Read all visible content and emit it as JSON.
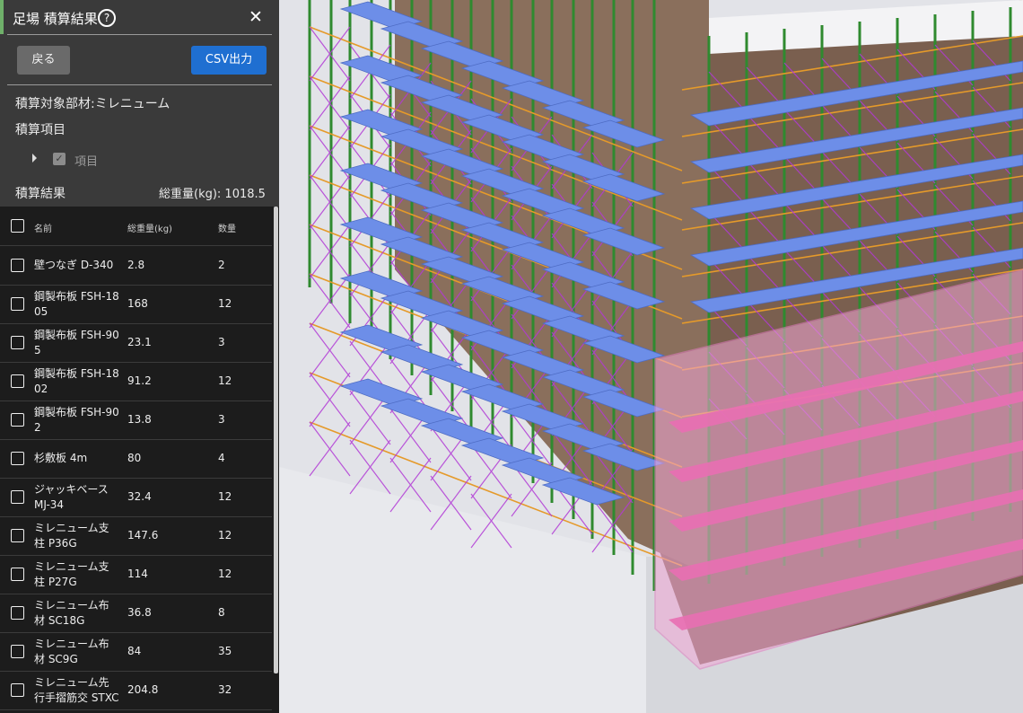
{
  "panel": {
    "title": "足場 積算結果",
    "help_icon": "?",
    "close_icon": "✕",
    "back_label": "戻る",
    "csv_label": "CSV出力",
    "target_label": "積算対象部材:ミレニューム",
    "items_label": "積算項目",
    "item_name": "項目",
    "result_label": "積算結果",
    "total_weight": "総重量(kg): 1018.5",
    "colors": {
      "accent": "#6fb06a",
      "csv_button": "#1f6fd1",
      "panel_bg": "#3a3a3a",
      "table_bg": "#1c1c1c"
    }
  },
  "table": {
    "headers": {
      "name": "名前",
      "weight": "総重量(kg)",
      "qty": "数量"
    },
    "rows": [
      {
        "name1": "壁つなぎ D-340",
        "name2": "",
        "weight": "2.8",
        "qty": "2"
      },
      {
        "name1": "鋼製布板 FSH-18",
        "name2": "05",
        "weight": "168",
        "qty": "12"
      },
      {
        "name1": "鋼製布板 FSH-90",
        "name2": "5",
        "weight": "23.1",
        "qty": "3"
      },
      {
        "name1": "鋼製布板 FSH-18",
        "name2": "02",
        "weight": "91.2",
        "qty": "12"
      },
      {
        "name1": "鋼製布板 FSH-90",
        "name2": "2",
        "weight": "13.8",
        "qty": "3"
      },
      {
        "name1": "杉敷板 4m",
        "name2": "",
        "weight": "80",
        "qty": "4"
      },
      {
        "name1": "ジャッキベース",
        "name2": "MJ-34",
        "weight": "32.4",
        "qty": "12"
      },
      {
        "name1": "ミレニューム支",
        "name2": "柱 P36G",
        "weight": "147.6",
        "qty": "12"
      },
      {
        "name1": "ミレニューム支",
        "name2": "柱 P27G",
        "weight": "114",
        "qty": "12"
      },
      {
        "name1": "ミレニューム布",
        "name2": "材 SC18G",
        "weight": "36.8",
        "qty": "8"
      },
      {
        "name1": "ミレニューム布",
        "name2": "材 SC9G",
        "weight": "84",
        "qty": "35"
      },
      {
        "name1": "ミレニューム先",
        "name2": "行手摺筋交 STXC",
        "weight": "204.8",
        "qty": "32"
      }
    ]
  }
}
